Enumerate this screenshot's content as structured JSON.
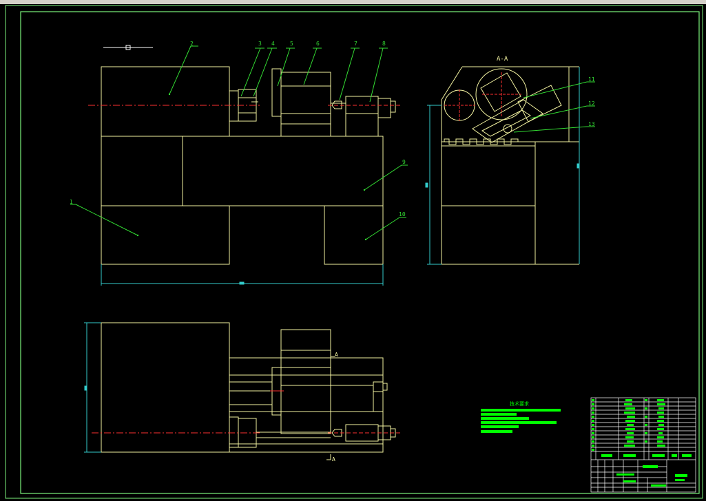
{
  "colors": {
    "background": "#000000",
    "frame": "#7cf27c",
    "outline": "#f2f2a0",
    "leader": "#33dd33",
    "centerline": "#ff3030",
    "dimension": "#33cccc",
    "notes_fill": "#00ff00",
    "white": "#ffffff"
  },
  "section_label": "A-A",
  "view_mark_a_top": "A",
  "view_mark_a_bottom": "A",
  "tech_title": "技术要求",
  "part_labels": [
    "1",
    "2",
    "3",
    "4",
    "5",
    "6",
    "7",
    "8",
    "9",
    "10",
    "11",
    "12",
    "13"
  ]
}
